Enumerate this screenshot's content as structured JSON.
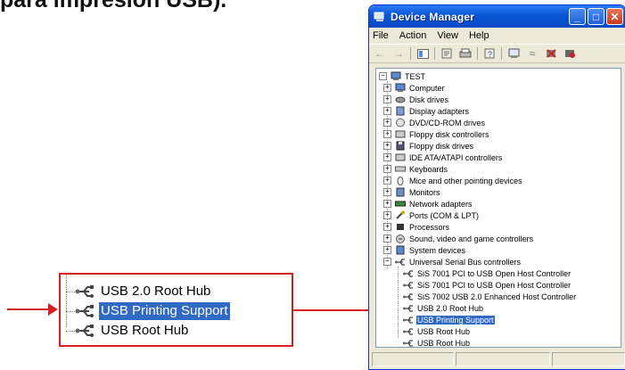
{
  "heading": "para impresión USB).",
  "callout": {
    "items": [
      {
        "label": "USB 2.0 Root Hub",
        "selected": false
      },
      {
        "label": "USB Printing Support",
        "selected": true
      },
      {
        "label": "USB Root Hub",
        "selected": false
      }
    ]
  },
  "window": {
    "title": "Device Manager",
    "menu": [
      "File",
      "Action",
      "View",
      "Help"
    ],
    "toolbar_icons": [
      "back-icon",
      "forward-icon",
      "show-hide-icon",
      "properties-icon",
      "print-icon",
      "help-icon",
      "scan-icon",
      "update-driver-icon",
      "uninstall-icon",
      "disable-icon"
    ],
    "tree": {
      "root": "TEST",
      "categories": [
        {
          "label": "Computer",
          "icon": "computer-icon"
        },
        {
          "label": "Disk drives",
          "icon": "disk-icon"
        },
        {
          "label": "Display adapters",
          "icon": "display-icon"
        },
        {
          "label": "DVD/CD-ROM drives",
          "icon": "cdrom-icon"
        },
        {
          "label": "Floppy disk controllers",
          "icon": "controller-icon"
        },
        {
          "label": "Floppy disk drives",
          "icon": "floppy-icon"
        },
        {
          "label": "IDE ATA/ATAPI controllers",
          "icon": "controller-icon"
        },
        {
          "label": "Keyboards",
          "icon": "keyboard-icon"
        },
        {
          "label": "Mice and other pointing devices",
          "icon": "mouse-icon"
        },
        {
          "label": "Monitors",
          "icon": "monitor-icon"
        },
        {
          "label": "Network adapters",
          "icon": "network-icon"
        },
        {
          "label": "Ports (COM & LPT)",
          "icon": "port-icon"
        },
        {
          "label": "Processors",
          "icon": "processor-icon"
        },
        {
          "label": "Sound, video and game controllers",
          "icon": "sound-icon"
        },
        {
          "label": "System devices",
          "icon": "system-icon"
        },
        {
          "label": "Universal Serial Bus controllers",
          "icon": "usb-icon",
          "expanded": true
        }
      ],
      "usb_children": [
        {
          "label": "SiS 7001 PCI to USB Open Host Controller",
          "selected": false
        },
        {
          "label": "SiS 7001 PCI to USB Open Host Controller",
          "selected": false
        },
        {
          "label": "SiS 7002 USB 2.0 Enhanced Host Controller",
          "selected": false
        },
        {
          "label": "USB 2.0 Root Hub",
          "selected": false
        },
        {
          "label": "USB Printing Support",
          "selected": true
        },
        {
          "label": "USB Root Hub",
          "selected": false
        },
        {
          "label": "USB Root Hub",
          "selected": false
        }
      ]
    }
  },
  "colors": {
    "highlight": "#d42020",
    "selection": "#316ac5",
    "titlebar": "#0a58d6"
  }
}
